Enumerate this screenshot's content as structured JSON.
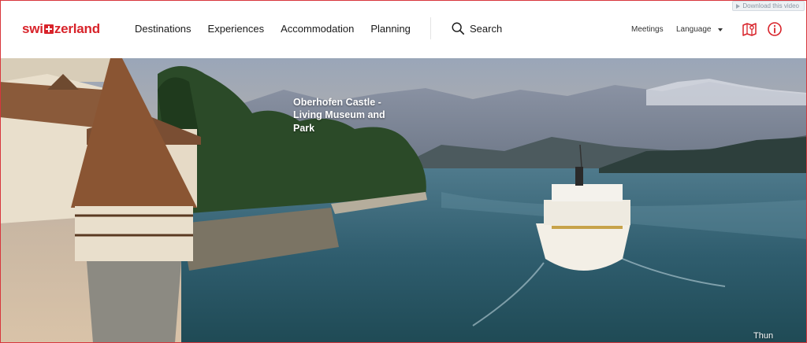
{
  "overlay": {
    "download_label": "Download this video"
  },
  "brand": {
    "name_left": "swi",
    "name_right": "zerland",
    "color": "#d8232a"
  },
  "nav": {
    "items": [
      {
        "label": "Destinations"
      },
      {
        "label": "Experiences"
      },
      {
        "label": "Accommodation"
      },
      {
        "label": "Planning"
      }
    ],
    "search_label": "Search"
  },
  "utility": {
    "meetings_label": "Meetings",
    "language_label": "Language"
  },
  "icons": [
    "search-icon",
    "map-icon",
    "info-icon",
    "chevron-down-icon",
    "play-icon"
  ],
  "hero": {
    "caption": "Oberhofen Castle - Living Museum and Park",
    "location": "Thun"
  }
}
